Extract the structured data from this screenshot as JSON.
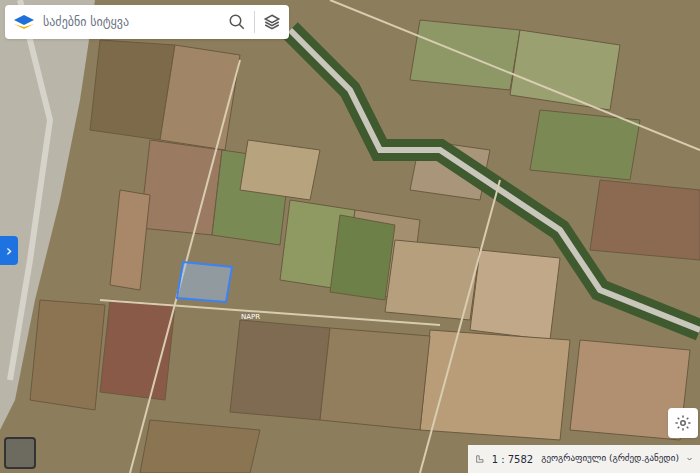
{
  "search": {
    "placeholder": "საძებნი სიტყვა"
  },
  "map": {
    "road_label": "NAPR",
    "highlighted_parcel": {
      "selected": true
    }
  },
  "side_panel_toggle": {
    "label": "›",
    "expanded": false
  },
  "status_bar": {
    "scale": "1 : 7582",
    "projection": "გეოგრაფიული (გრძედ.განედი)"
  }
}
